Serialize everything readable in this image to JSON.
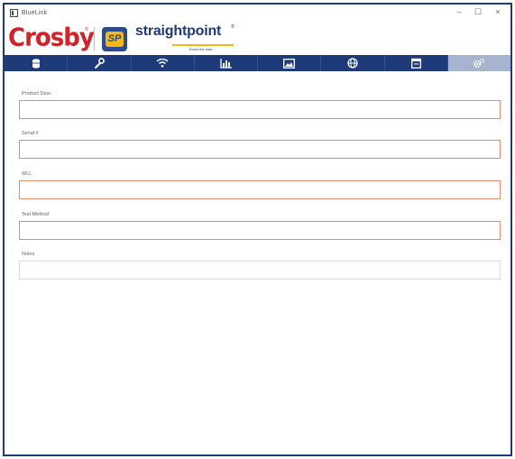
{
  "window": {
    "title": "BlueLink",
    "controls": {
      "minimize": "–",
      "maximize": "☐",
      "close": "×"
    }
  },
  "brand": {
    "crosby": "Crosby",
    "sp_mark": "SP",
    "straightpoint": "straightpoint",
    "tagline": "Know the load",
    "crosby_color": "#d52127",
    "sp_navy": "#1e3a78",
    "sp_yellow": "#f4b717"
  },
  "nav": {
    "tabs": [
      {
        "icon": "database-icon"
      },
      {
        "icon": "wrench-icon"
      },
      {
        "icon": "wifi-icon"
      },
      {
        "icon": "chart-icon"
      },
      {
        "icon": "image-icon"
      },
      {
        "icon": "globe-icon"
      },
      {
        "icon": "calendar-icon"
      },
      {
        "icon": "settings-icon",
        "active": true
      }
    ],
    "bar_color": "#1e3a78",
    "active_color": "#a6b4cf"
  },
  "form": {
    "fields": [
      {
        "label": "Product Desc",
        "value": "",
        "invalid": true
      },
      {
        "label": "Serial #",
        "value": "",
        "invalid": true
      },
      {
        "label": "WLL",
        "value": "",
        "invalid": true
      },
      {
        "label": "Test Method",
        "value": "",
        "invalid": true
      },
      {
        "label": "Notes",
        "value": "",
        "invalid": false
      }
    ],
    "invalid_border_color": "#e58b6c"
  }
}
